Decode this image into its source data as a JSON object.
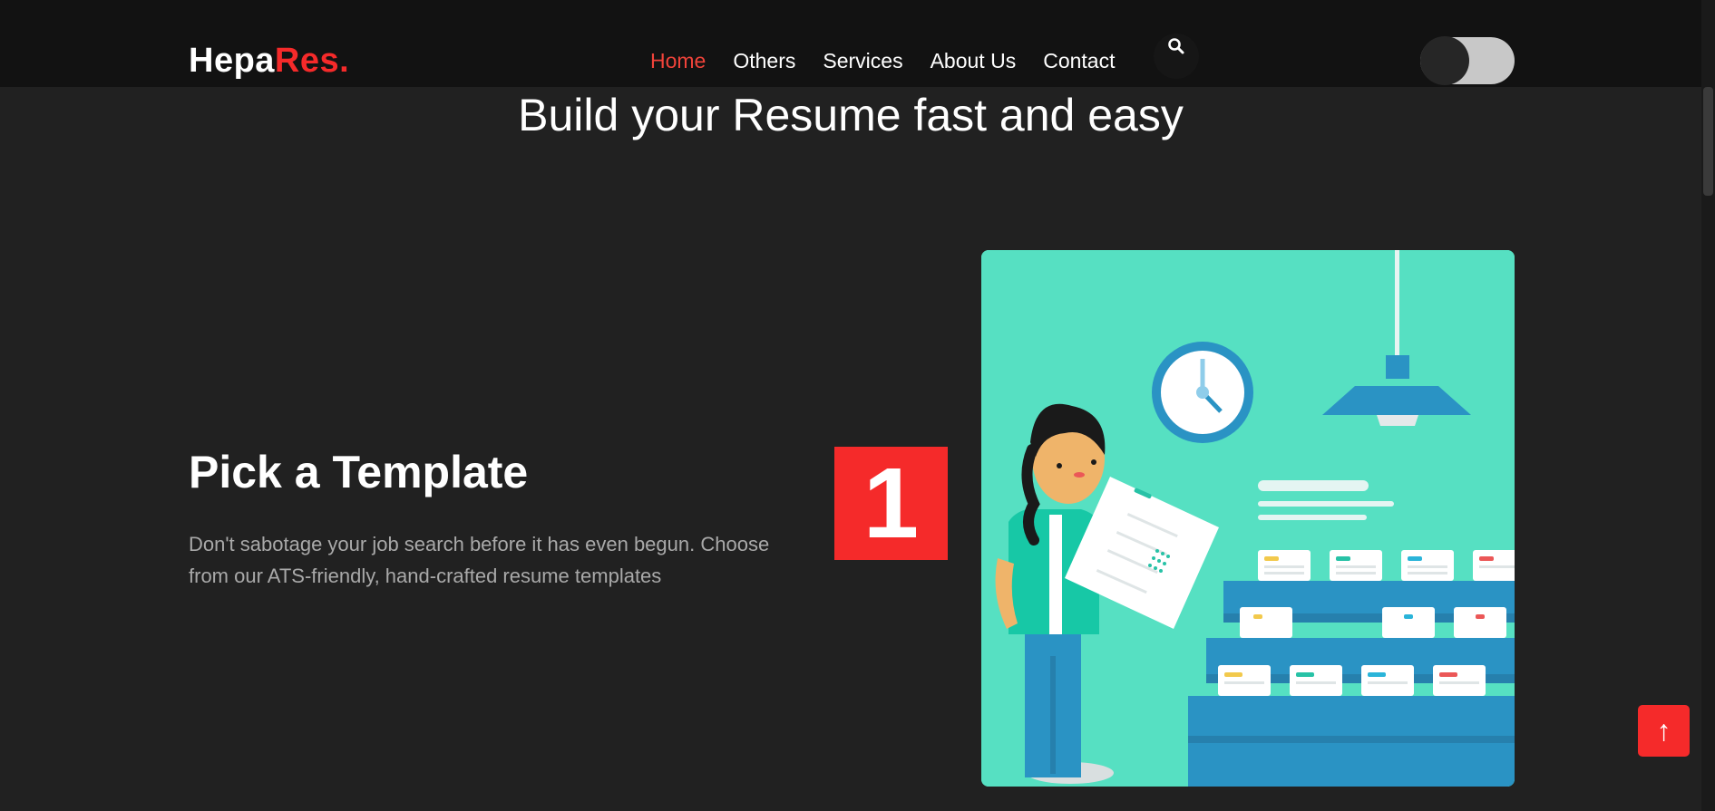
{
  "brand": {
    "name_part1": "Hepa",
    "name_part2": "Res."
  },
  "nav": {
    "items": [
      "Home",
      "Others",
      "Services",
      "About Us",
      "Contact"
    ],
    "active": "Home"
  },
  "search": {
    "icon": "search-icon"
  },
  "theme_toggle": {
    "state": "off"
  },
  "hero": {
    "title": "Build your Resume fast and easy"
  },
  "step": {
    "number": "1",
    "title": "Pick a Template",
    "description": "Don't sabotage your job search before it has even begun. Choose from our ATS-friendly, hand-crafted resume templates"
  },
  "back_to_top": {
    "label": "↑"
  },
  "colors": {
    "accent": "#f52a2a",
    "background": "#212121",
    "header": "#121212",
    "illustration_bg": "#56e0c2"
  }
}
